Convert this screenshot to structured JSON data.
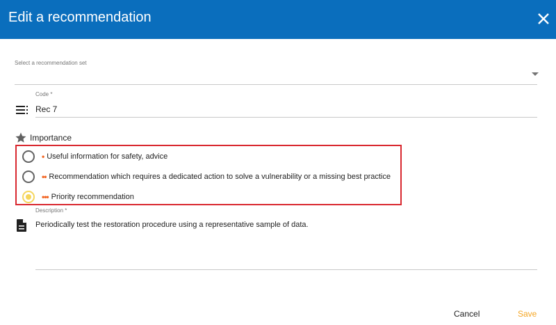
{
  "dialog": {
    "title": "Edit a recommendation",
    "close_icon": "close-icon"
  },
  "form": {
    "recommendation_set": {
      "label": "Select a recommendation set",
      "value": ""
    },
    "code": {
      "label": "Code *",
      "value": "Rec 7",
      "icon": "list-icon"
    },
    "importance": {
      "label": "Importance",
      "icon": "star-icon",
      "options": [
        {
          "bullets": "•",
          "label": "Useful information for safety, advice",
          "checked": false
        },
        {
          "bullets": "••",
          "label": "Recommendation which requires a dedicated action to solve a vulnerability or a missing best practice",
          "checked": false
        },
        {
          "bullets": "•••",
          "label": "Priority recommendation",
          "checked": true
        }
      ]
    },
    "description": {
      "label": "Description *",
      "value": "Periodically test the restoration procedure using a representative sample of data.",
      "icon": "document-icon"
    }
  },
  "actions": {
    "cancel_label": "Cancel",
    "save_label": "Save"
  },
  "colors": {
    "header": "#0a6ebd",
    "accent": "#f5a623",
    "bullet": "#f26522",
    "highlight": "#d9282f",
    "radio_checked": "#f5d65c"
  }
}
